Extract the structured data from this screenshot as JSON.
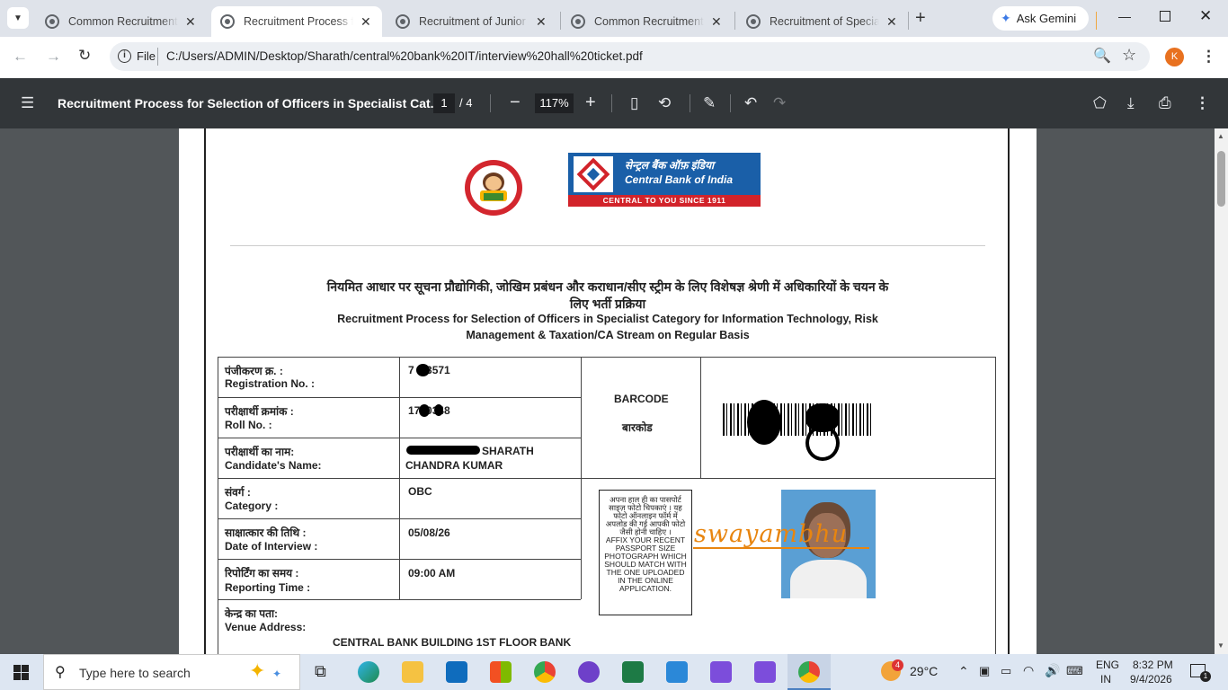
{
  "tabs": [
    {
      "title": "Common Recruitment Process"
    },
    {
      "title": "Recruitment Process for Selection"
    },
    {
      "title": "Recruitment of Junior Associates"
    },
    {
      "title": "Common Recruitment Process"
    },
    {
      "title": "Recruitment of Specialist Officers"
    }
  ],
  "gemini": {
    "label": "Ask Gemini"
  },
  "address": {
    "scheme": "File",
    "url": "C:/Users/ADMIN/Desktop/Sharath/central%20bank%20IT/interview%20hall%20ticket.pdf"
  },
  "profile": {
    "initial": "K"
  },
  "pdf": {
    "title": "Recruitment Process for Selection of Officers in Specialist Cat...",
    "page_current": "1",
    "page_total": "/ 4",
    "zoom": "117%"
  },
  "doc": {
    "bank_name_hi": "सेन्ट्रल बैंक ऑफ़ इंडिया",
    "bank_name_en": "Central Bank of India",
    "bank_tagline": "CENTRAL TO YOU SINCE 1911",
    "heading_hi_1": "नियमित आधार पर सूचना प्रौद्योगिकी, जोखिम प्रबंधन और कराधान/सीए स्ट्रीम के लिए विशेषज्ञ श्रेणी में अधिकारियों के चयन के",
    "heading_hi_2": "लिए भर्ती प्रक्रिया",
    "heading_en_1": "Recruitment Process for Selection of Officers in Specialist Category for Information Technology, Risk",
    "heading_en_2": "Management & Taxation/CA Stream on Regular Basis",
    "rows": [
      {
        "hi": "पंजीकरण क्र. :",
        "en": "Registration No. :",
        "value": "7  13571"
      },
      {
        "hi": "परीक्षार्थी क्रमांक :",
        "en": "Roll No. :",
        "value": "17  0348"
      },
      {
        "hi": "परीक्षार्थी का नाम:",
        "en": "Candidate's Name:",
        "value": "SHARATH",
        "value2": "CHANDRA KUMAR"
      },
      {
        "hi": "संवर्ग :",
        "en": "Category :",
        "value": "OBC"
      },
      {
        "hi": "साक्षात्कार की तिथि :",
        "en": "Date of Interview :",
        "value": "05/08/26"
      },
      {
        "hi": "रिपोर्टिंग का समय :",
        "en": "Reporting Time :",
        "value": "09:00 AM"
      },
      {
        "hi": "केन्द्र का पता:",
        "en": "Venue Address:",
        "value": "CENTRAL BANK BUILDING 1ST FLOOR BANK"
      }
    ],
    "barcode_en": "BARCODE",
    "barcode_hi": "बारकोड",
    "photo_box_hi": "अपना हाल ही का पासपोर्ट साइज़ फोटो चिपकाएं । यह फोटो ऑनलाइन फॉर्म में अपलोड की गई आपकी फोटो जैसी होनी चाहिए ।",
    "photo_box_en": "AFFIX YOUR RECENT PASSPORT SIZE PHOTOGRAPH WHICH SHOULD MATCH WITH THE ONE UPLOADED IN THE ONLINE APPLICATION.",
    "signature": "swayambhu"
  },
  "taskbar": {
    "search_placeholder": "Type here to search",
    "weather_temp": "29°C",
    "weather_badge": "4",
    "lang": "ENG",
    "region": "IN",
    "time": "8:32 PM",
    "date": "9/4/2026",
    "notif_count": "1"
  }
}
